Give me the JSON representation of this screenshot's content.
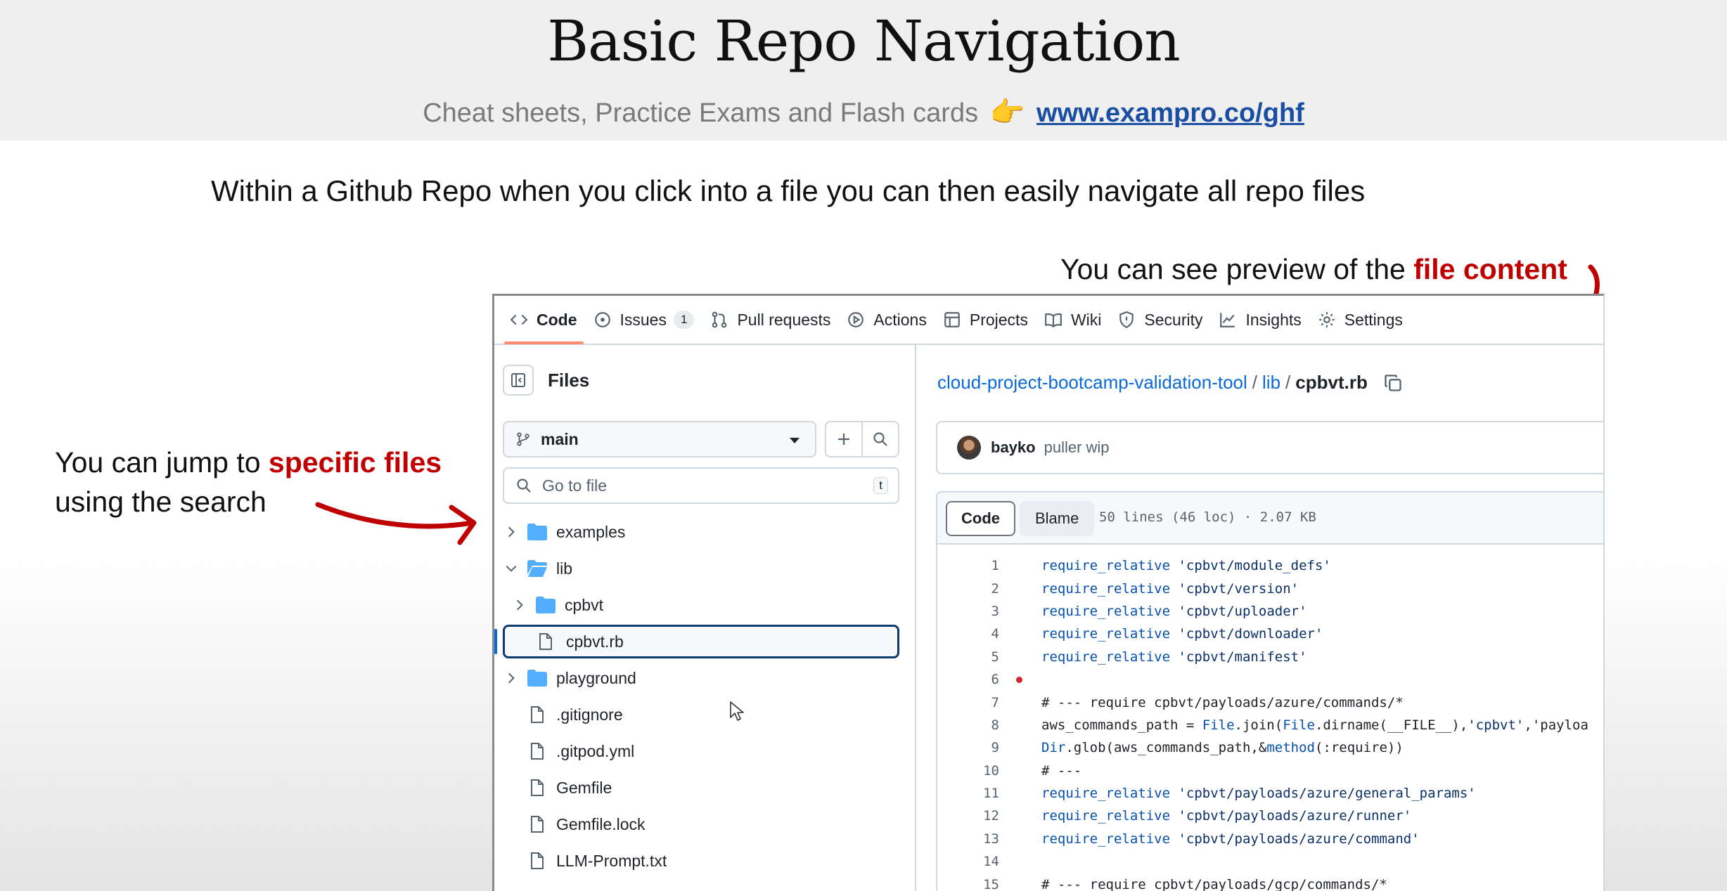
{
  "slide": {
    "title": "Basic Repo Navigation",
    "promo_text": "Cheat sheets, Practice Exams and Flash cards",
    "promo_emoji": "👉",
    "promo_link": "www.exampro.co/ghf",
    "intro": "Within a Github Repo when you click into a file you can then easily navigate all repo files",
    "callout_preview_prefix": "You can see preview of the ",
    "callout_preview_highlight": "file content",
    "callout_search_prefix": "You can jump to ",
    "callout_search_highlight": "specific files",
    "callout_search_suffix": "using the search",
    "highlight_color": "#c00000"
  },
  "repo_nav": {
    "tabs": [
      {
        "label": "Code",
        "icon": "code-icon",
        "active": true
      },
      {
        "label": "Issues",
        "icon": "issue-opened-icon",
        "count": "1"
      },
      {
        "label": "Pull requests",
        "icon": "git-pull-request-icon"
      },
      {
        "label": "Actions",
        "icon": "play-icon"
      },
      {
        "label": "Projects",
        "icon": "table-icon"
      },
      {
        "label": "Wiki",
        "icon": "book-icon"
      },
      {
        "label": "Security",
        "icon": "shield-icon"
      },
      {
        "label": "Insights",
        "icon": "graph-icon"
      },
      {
        "label": "Settings",
        "icon": "gear-icon"
      }
    ]
  },
  "sidebar": {
    "title": "Files",
    "branch": "main",
    "search_placeholder": "Go to file",
    "search_shortcut": "t",
    "tree": [
      {
        "label": "examples",
        "type": "folder",
        "expanded": false
      },
      {
        "label": "lib",
        "type": "folder",
        "expanded": true
      },
      {
        "label": "cpbvt",
        "type": "folder",
        "expanded": false
      },
      {
        "label": "cpbvt.rb",
        "type": "file",
        "selected": true
      },
      {
        "label": "playground",
        "type": "folder",
        "expanded": false
      },
      {
        "label": ".gitignore",
        "type": "file"
      },
      {
        "label": ".gitpod.yml",
        "type": "file"
      },
      {
        "label": "Gemfile",
        "type": "file"
      },
      {
        "label": "Gemfile.lock",
        "type": "file"
      },
      {
        "label": "LLM-Prompt.txt",
        "type": "file"
      }
    ]
  },
  "file_view": {
    "breadcrumb": {
      "repo": "cloud-project-bootcamp-validation-tool",
      "sep1": "/",
      "dir": "lib",
      "sep2": "/",
      "file": "cpbvt.rb"
    },
    "commit": {
      "author": "bayko",
      "message": "puller wip"
    },
    "view_tabs": {
      "code": "Code",
      "blame": "Blame"
    },
    "meta": "50 lines (46 loc) · 2.07 KB",
    "lines": [
      {
        "n": "1",
        "text": "require_relative 'cpbvt/module_defs'"
      },
      {
        "n": "2",
        "text": "require_relative 'cpbvt/version'"
      },
      {
        "n": "3",
        "text": "require_relative 'cpbvt/uploader'"
      },
      {
        "n": "4",
        "text": "require_relative 'cpbvt/downloader'"
      },
      {
        "n": "5",
        "text": "require_relative 'cpbvt/manifest'"
      },
      {
        "n": "6",
        "text": ""
      },
      {
        "n": "7",
        "text": "# --- require cpbvt/payloads/azure/commands/*"
      },
      {
        "n": "8",
        "text": "aws_commands_path = File.join(File.dirname(__FILE__),'cpbvt','payloa"
      },
      {
        "n": "9",
        "text": "Dir.glob(aws_commands_path,&method(:require))"
      },
      {
        "n": "10",
        "text": "# ---"
      },
      {
        "n": "11",
        "text": "require_relative 'cpbvt/payloads/azure/general_params'"
      },
      {
        "n": "12",
        "text": "require_relative 'cpbvt/payloads/azure/runner'"
      },
      {
        "n": "13",
        "text": "require_relative 'cpbvt/payloads/azure/command'"
      },
      {
        "n": "14",
        "text": ""
      },
      {
        "n": "15",
        "text": "# --- require cpbvt/payloads/gcp/commands/*"
      }
    ]
  }
}
